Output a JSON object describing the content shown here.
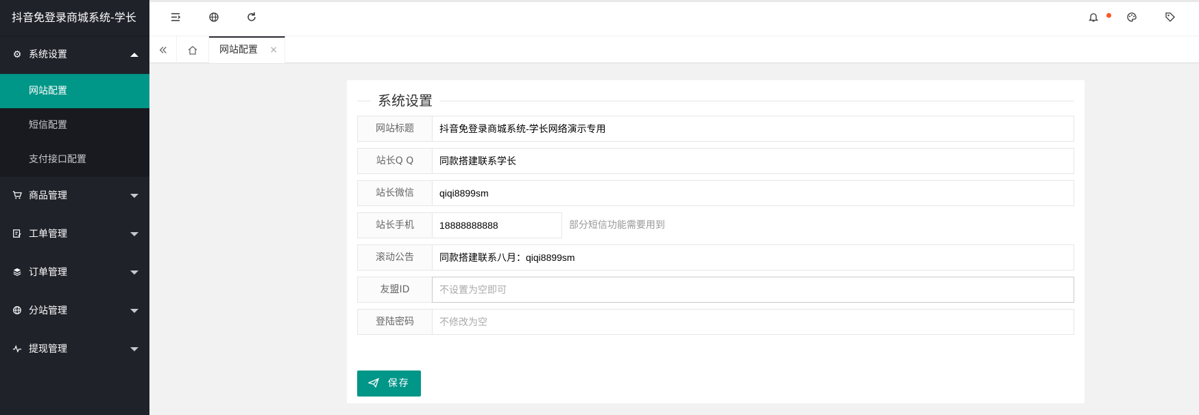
{
  "app": {
    "title": "抖音免登录商城系统-学长"
  },
  "sidebar": {
    "items": [
      {
        "label": "系统设置",
        "icon": "gear-icon",
        "expanded": true,
        "children": [
          {
            "label": "网站配置",
            "active": true
          },
          {
            "label": "短信配置"
          },
          {
            "label": "支付接口配置"
          }
        ]
      },
      {
        "label": "商品管理",
        "icon": "cart-icon"
      },
      {
        "label": "工单管理",
        "icon": "ticket-icon"
      },
      {
        "label": "订单管理",
        "icon": "layers-icon"
      },
      {
        "label": "分站管理",
        "icon": "globe-icon"
      },
      {
        "label": "提现管理",
        "icon": "pulse-icon"
      }
    ]
  },
  "header": {
    "icons": [
      "menu-fold-icon",
      "globe-icon",
      "refresh-icon",
      "bell-icon",
      "palette-icon",
      "tag-icon"
    ],
    "notification_dot_color": "#ff5722"
  },
  "tabs": {
    "active_label": "网站配置",
    "close_glyph": "×"
  },
  "form": {
    "legend": "系统设置",
    "fields": [
      {
        "label": "网站标题",
        "value": "抖音免登录商城系统-学长网络演示专用",
        "placeholder": ""
      },
      {
        "label": "站长Q Q",
        "value": "同款搭建联系学长",
        "placeholder": ""
      },
      {
        "label": "站长微信",
        "value": "qiqi8899sm",
        "placeholder": ""
      },
      {
        "label": "站长手机",
        "value": "18888888888",
        "placeholder": "",
        "aux": "部分短信功能需要用到"
      },
      {
        "label": "滚动公告",
        "value": "同款搭建联系八月：qiqi8899sm",
        "placeholder": ""
      },
      {
        "label": "友盟ID",
        "value": "",
        "placeholder": "不设置为空即可"
      },
      {
        "label": "登陆密码",
        "value": "",
        "placeholder": "不修改为空"
      }
    ],
    "save_label": "保存"
  },
  "colors": {
    "accent": "#009688",
    "sidebar_bg": "#20222a",
    "subnav_bg": "#191a20"
  }
}
